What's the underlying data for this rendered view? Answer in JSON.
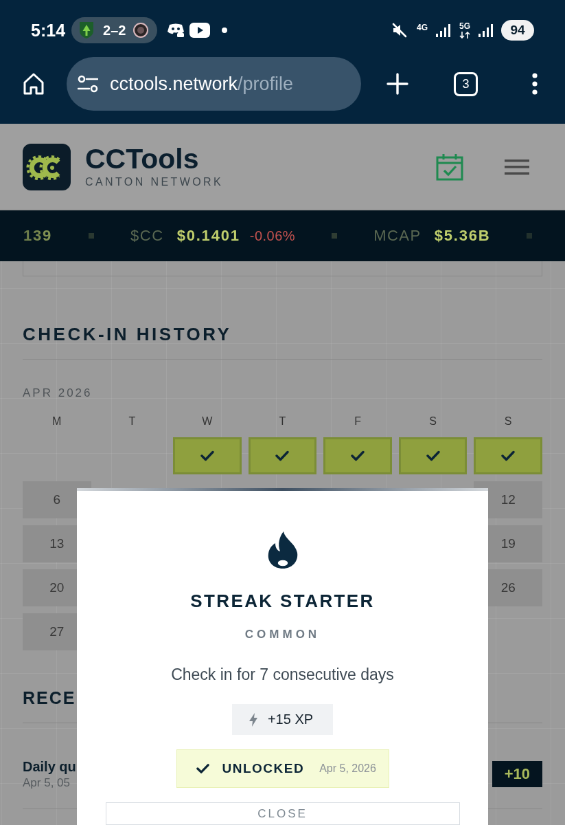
{
  "status_bar": {
    "time": "5:14",
    "score": "2–2",
    "networks": [
      {
        "label": "4G",
        "activity": false
      },
      {
        "label": "5G",
        "activity": true
      }
    ],
    "battery": "94"
  },
  "browser": {
    "url_host": "cctools.network",
    "url_path": "/profile",
    "tab_count": "3"
  },
  "header": {
    "title": "CCTools",
    "subtitle": "CANTON NETWORK"
  },
  "ticker": [
    {
      "value": "139"
    },
    {
      "label": "$CC",
      "value": "$0.1401",
      "change": "-0.06%"
    },
    {
      "label": "MCAP",
      "value": "$5.36B"
    }
  ],
  "check_in_history": {
    "title": "CHECK-IN HISTORY",
    "month": "APR 2026",
    "weekdays": [
      "M",
      "T",
      "W",
      "T",
      "F",
      "S",
      "S"
    ],
    "weeks": [
      {
        "days": [
          {
            "kind": "blank"
          },
          {
            "kind": "blank"
          },
          {
            "kind": "day",
            "checked": true
          },
          {
            "kind": "day",
            "checked": true
          },
          {
            "kind": "day",
            "checked": true
          },
          {
            "kind": "day",
            "checked": true
          },
          {
            "kind": "day",
            "checked": true
          }
        ]
      },
      {
        "days": [
          {
            "kind": "day",
            "label": "6",
            "checked": false
          },
          {
            "kind": "blank"
          },
          {
            "kind": "blank"
          },
          {
            "kind": "blank"
          },
          {
            "kind": "blank"
          },
          {
            "kind": "blank"
          },
          {
            "kind": "day",
            "label": "12",
            "checked": false
          }
        ]
      },
      {
        "days": [
          {
            "kind": "day",
            "label": "13",
            "checked": false
          },
          {
            "kind": "blank"
          },
          {
            "kind": "blank"
          },
          {
            "kind": "blank"
          },
          {
            "kind": "blank"
          },
          {
            "kind": "blank"
          },
          {
            "kind": "day",
            "label": "19",
            "checked": false
          }
        ]
      },
      {
        "days": [
          {
            "kind": "day",
            "label": "20",
            "checked": false
          },
          {
            "kind": "blank"
          },
          {
            "kind": "blank"
          },
          {
            "kind": "blank"
          },
          {
            "kind": "blank"
          },
          {
            "kind": "blank"
          },
          {
            "kind": "day",
            "label": "26",
            "checked": false
          }
        ]
      },
      {
        "days": [
          {
            "kind": "day",
            "label": "27",
            "checked": false
          },
          {
            "kind": "blank"
          },
          {
            "kind": "blank"
          },
          {
            "kind": "blank"
          },
          {
            "kind": "blank"
          },
          {
            "kind": "blank"
          },
          {
            "kind": "blank"
          }
        ]
      }
    ]
  },
  "recent_activity": {
    "title": "RECE",
    "items": [
      {
        "title": "Daily qu",
        "date": "Apr 5, 05",
        "points": "+10"
      }
    ]
  },
  "achievement_modal": {
    "title": "STREAK STARTER",
    "rarity": "COMMON",
    "description": "Check in for 7 consecutive days",
    "reward": "+15 XP",
    "unlocked": true,
    "status_label": "UNLOCKED",
    "unlocked_date": "Apr 5, 2026",
    "button": "CLOSE"
  }
}
